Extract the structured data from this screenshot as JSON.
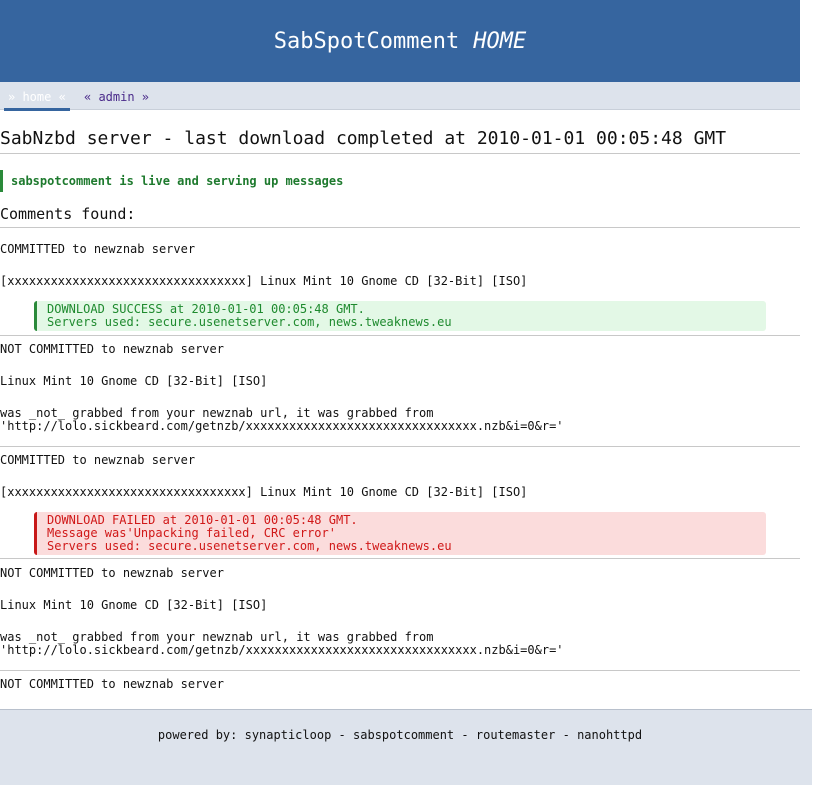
{
  "header": {
    "title": "SabSpotComment",
    "section": "HOME"
  },
  "nav": {
    "home": "» home «",
    "admin": "« admin »"
  },
  "page_title": "SabNzbd server - last download completed at 2010-01-01 00:05:48 GMT",
  "live_message": "sabspotcomment is live and serving up messages",
  "comments_heading": "Comments found:",
  "comments": [
    {
      "status": "COMMITTED to newznab server",
      "title": "[xxxxxxxxxxxxxxxxxxxxxxxxxxxxxxxxx] Linux Mint 10 Gnome CD [32-Bit] [ISO]",
      "result_lines": [
        "DOWNLOAD SUCCESS at 2010-01-01 00:05:48 GMT.",
        "Servers used: secure.usenetserver.com, news.tweaknews.eu"
      ]
    },
    {
      "status": "NOT COMMITTED to newznab server",
      "title": "Linux Mint 10 Gnome CD [32-Bit] [ISO]",
      "message_lines": [
        "was _not_ grabbed from your newznab url, it was grabbed from",
        "'http://lolo.sickbeard.com/getnzb/xxxxxxxxxxxxxxxxxxxxxxxxxxxxxxxx.nzb&i=0&r='"
      ]
    },
    {
      "status": "COMMITTED to newznab server",
      "title": "[xxxxxxxxxxxxxxxxxxxxxxxxxxxxxxxxx] Linux Mint 10 Gnome CD [32-Bit] [ISO]",
      "result_lines": [
        "DOWNLOAD FAILED at 2010-01-01 00:05:48 GMT.",
        "Message was'Unpacking failed, CRC error'",
        "Servers used: secure.usenetserver.com, news.tweaknews.eu"
      ]
    },
    {
      "status": "NOT COMMITTED to newznab server",
      "title": "Linux Mint 10 Gnome CD [32-Bit] [ISO]",
      "message_lines": [
        "was _not_ grabbed from your newznab url, it was grabbed from",
        "'http://lolo.sickbeard.com/getnzb/xxxxxxxxxxxxxxxxxxxxxxxxxxxxxxxx.nzb&i=0&r='"
      ]
    },
    {
      "status": "NOT COMMITTED to newznab server"
    }
  ],
  "footer": {
    "prefix": "powered by:",
    "links": [
      "synapticloop",
      "sabspotcomment",
      "routemaster",
      "nanohttpd"
    ],
    "separator": "-"
  },
  "colors": {
    "header_bg": "#36659f",
    "nav_bg": "#dde3ec",
    "success_text": "#1e8a2e",
    "success_bg": "#e3f8e6",
    "failed_text": "#d01818",
    "failed_bg": "#fbdcdc"
  }
}
